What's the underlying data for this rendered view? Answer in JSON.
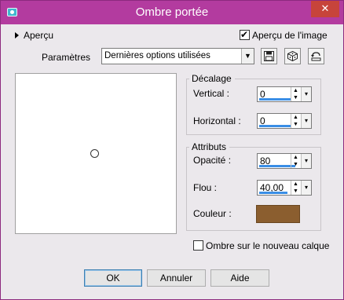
{
  "window": {
    "title": "Ombre portée",
    "close_label": "✕"
  },
  "preview": {
    "toggle_label": "Aperçu",
    "image_preview_label": "Aperçu de l'image",
    "image_preview_checked": true
  },
  "params": {
    "label": "Paramètres",
    "preset_value": "Dernières options utilisées"
  },
  "offset": {
    "title": "Décalage",
    "vertical_label": "Vertical :",
    "vertical_value": "0",
    "horizontal_label": "Horizontal :",
    "horizontal_value": "0"
  },
  "attributes": {
    "title": "Attributs",
    "opacity_label": "Opacité :",
    "opacity_value": "80",
    "blur_label": "Flou :",
    "blur_value": "40,00",
    "color_label": "Couleur :",
    "color": "#8b5e2f"
  },
  "new_layer": {
    "label": "Ombre sur le nouveau calque",
    "checked": false
  },
  "buttons": {
    "ok": "OK",
    "cancel": "Annuler",
    "help": "Aide"
  },
  "accent": {
    "titlebar": "#b33b9f",
    "close": "#c7443b",
    "spin_highlight": "#3a8ee6"
  }
}
